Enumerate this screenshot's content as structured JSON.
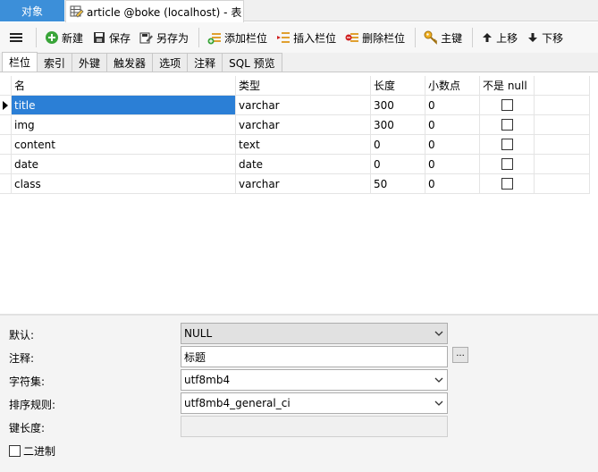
{
  "tabs": {
    "objects_label": "对象",
    "document_title": "article @boke (localhost) - 表"
  },
  "toolbar": {
    "new_label": "新建",
    "save_label": "保存",
    "save_as_label": "另存为",
    "add_field_label": "添加栏位",
    "insert_field_label": "插入栏位",
    "delete_field_label": "删除栏位",
    "primary_key_label": "主键",
    "move_up_label": "上移",
    "move_down_label": "下移"
  },
  "subtabs": [
    {
      "label": "栏位",
      "active": true
    },
    {
      "label": "索引",
      "active": false
    },
    {
      "label": "外键",
      "active": false
    },
    {
      "label": "触发器",
      "active": false
    },
    {
      "label": "选项",
      "active": false
    },
    {
      "label": "注释",
      "active": false
    },
    {
      "label": "SQL 预览",
      "active": false
    }
  ],
  "grid": {
    "columns": [
      "名",
      "类型",
      "长度",
      "小数点",
      "不是 null"
    ],
    "rows": [
      {
        "name": "title",
        "type": "varchar",
        "length": "300",
        "decimals": "0",
        "not_null": false,
        "selected": true
      },
      {
        "name": "img",
        "type": "varchar",
        "length": "300",
        "decimals": "0",
        "not_null": false,
        "selected": false
      },
      {
        "name": "content",
        "type": "text",
        "length": "0",
        "decimals": "0",
        "not_null": false,
        "selected": false
      },
      {
        "name": "date",
        "type": "date",
        "length": "0",
        "decimals": "0",
        "not_null": false,
        "selected": false
      },
      {
        "name": "class",
        "type": "varchar",
        "length": "50",
        "decimals": "0",
        "not_null": false,
        "selected": false
      }
    ]
  },
  "properties": {
    "default_label": "默认:",
    "default_value": "NULL",
    "comment_label": "注释:",
    "comment_value": "标题",
    "ellipsis_label": "...",
    "charset_label": "字符集:",
    "charset_value": "utf8mb4",
    "collation_label": "排序规则:",
    "collation_value": "utf8mb4_general_ci",
    "key_length_label": "键长度:",
    "binary_label": "二进制",
    "binary_checked": false
  },
  "colors": {
    "accent": "#3c8fd9",
    "selection": "#2b7fd6"
  }
}
